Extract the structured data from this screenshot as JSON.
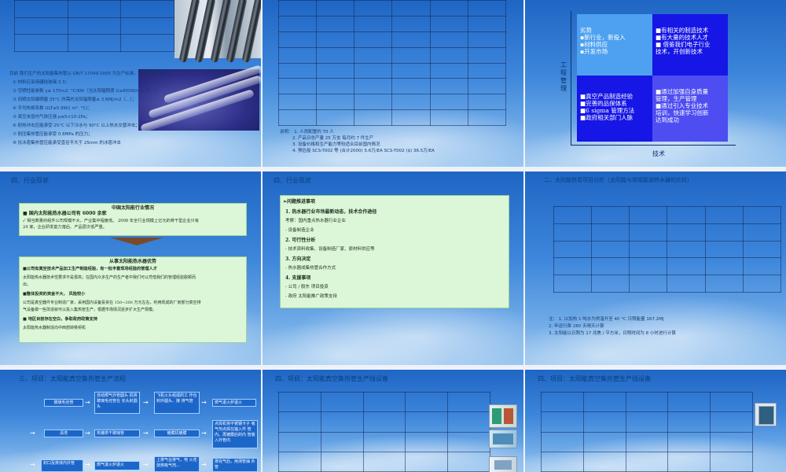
{
  "slides": {
    "s1": {
      "intro": "目前 我们生产的太阳能集热管以 GB/T 17049-2005 为生产标准，主要性能参数如下：",
      "items": [
        "① 材料应采用硼硅玻璃 3.3；",
        "② 空晒性能参数 y≥ 175m2. °C/KW（当太阳辐照度  G≥800W/m2 时…）；",
        "③ 闷晒太阳曝晒量 35°C 所需的太阳辐照量≤ 3.8MJ/m2（…）；",
        "④ 平均热损系数 ULT≤0.9W/( m². °C)；",
        "⑤ 真空夹层内气体压强  p≤5×10-2Pa；",
        "⑥ 耐热冲击应能承受 25°C 以下冷水与 90°C 以上热水交替冲击；",
        "⑦ 耐压集热管应能承受 0.6MPa 的压力；",
        "⑧ 抗冰雹集热管应能承受直径不大于 25mm 的冰雹冲击"
      ]
    },
    "s2": {
      "notes": [
        "说明：  1. 人员配置约 70 人",
        "2. 产品日总产量 25 万支    每月约 7 件生产",
        "3. 设备价格和生产能力等较适合目前国内情况",
        "4. 预估投     SCS-T002 等      (合计2000) 5.6万/EA SCS-T002 ($) 36.5万/EA"
      ]
    },
    "s3": {
      "cells": {
        "tl": [
          "劣势",
          "▪新行业，新投入",
          "▪材料供应",
          "▪开发市场"
        ],
        "tr": [
          "■有相关的制造技术",
          "■有大量的技术人才",
          "■  借鉴我们电子行业",
          "     技术，开创新技术"
        ],
        "bl": [
          "■真空产品制造经验",
          "■完善的品保体系",
          "■6 sigma 管理方法",
          "■政府相关部门人脉"
        ],
        "br": [
          "■通过加强自身质量",
          "     管理，生产管理",
          "■通过引入专业技术",
          "     培训，快速学习创新",
          "     达到成功"
        ]
      },
      "y_axis": "工程管理",
      "x_axis": "技术"
    },
    "s4": {
      "title": "四、行业现状",
      "box1_title": "中国太阳能行业情况",
      "box1_lines": [
        "■  国内太阳能热水器公司有 6000 余家",
        "✓  相当数量的组件公司规模不大，产业集中程度低。 2008 年全行业规模上亿元的骨干型企业只有",
        "24 家，企业研发能力落后、产品层次低严重。"
      ],
      "box2_title": "从事太阳能热水器优势",
      "box2_lines": [
        "■公司有真空技术产品加工生产制造经验，有一批丰富现场经验的管理人才",
        "太阳能热水器技术性要求不是很高；在国内众多生产的生产者中我们可以凭借我们的管理经验脱颖而",
        "出。",
        "■整体投资的资金不大，  风险较小",
        "公司是真空器件专业制造厂家，采用国内设备投资在 150~200 万元左右，利用现成的厂房部分真空排",
        "气设备做一些改造就可以投入集热管生产，根据市场情况逐步扩大生产规模。",
        "■  地区目前存在空白，争取政府政策支持",
        "太阳能热水器制造向中西部转移契机"
      ]
    },
    "s5": {
      "title": "四、行业现状",
      "header": "➢问题推进事项",
      "lines": [
        "1. 热水器行业市场最新动态，技术合作途径",
        "  考察：国内重点热水器行业企业",
        "        - 设备制造企业",
        "2. 可行性分析",
        "  - 技术资料收集、设备制造厂家、原材料供应等",
        "3. 方向决定",
        "  - 热水器成集热管合作方式",
        "4. 支援事项",
        "  - 公司 / 股东  项目投资",
        "  - 政府  太阳能推广政策支持"
      ]
    },
    "s6": {
      "title": "二、太阳能热管项目分析（太阳能与常规能源热水器的比较）",
      "notes": [
        "注：  1. 以加热 1 吨水为例温升至 40 °C  日照能量 167.2MJ",
        "       2. 年运行费 280 天晴天计算",
        "       3. 太阳能以日照为 17 兆焦 / 平方米，日照时间为 8 小时进行计算"
      ]
    },
    "s7": {
      "title": "三、项目：太阳能真空集热管生产流程",
      "boxes": [
        "玻璃毛坯管",
        "自动燃气外管圆头 机将玻璃毛坯管在 长头封圆头",
        "飞机火头组成的工 作台封外圆头、接 排气管",
        "燃气退火炉退火",
        "清洗",
        "热镀烘干玻璃管",
        "镀膜机镀膜",
        "点焊机将不锈钢卡子 吸气剂点焊在输入件 管内。再镀膜后的内 管装入外管内",
        "封口及排液内外管",
        "燃气退火炉退火",
        "上排气台排气，电 火花烧热吸气剂...",
        "排完气后，用测管抽 外管"
      ]
    },
    "s8": {
      "title": "四、项目：太阳能真空集热管生产线设备"
    },
    "s9": {
      "title": "四、项目：太阳能真空集热管生产线设备"
    }
  }
}
